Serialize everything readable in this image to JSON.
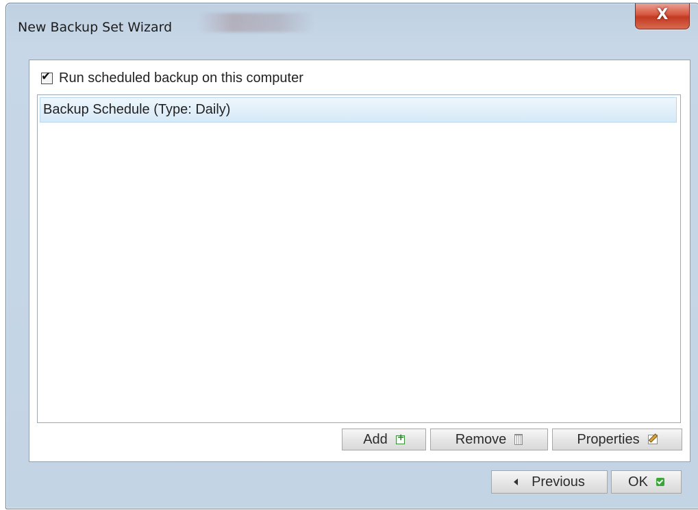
{
  "window": {
    "title": "New Backup Set Wizard",
    "close_glyph": "X"
  },
  "schedule": {
    "run_scheduled_label": "Run scheduled backup on this computer",
    "run_scheduled_checked": true,
    "items": [
      {
        "label": "Backup Schedule (Type: Daily)",
        "selected": true
      }
    ]
  },
  "list_actions": {
    "add_label": "Add",
    "remove_label": "Remove",
    "properties_label": "Properties"
  },
  "navigation": {
    "previous_label": "Previous",
    "ok_label": "OK"
  },
  "icons": {
    "add": "add-icon",
    "remove": "trash-icon",
    "properties": "edit-icon",
    "previous": "arrow-left-icon",
    "ok": "check-icon"
  },
  "colors": {
    "window_frame": "#c3d4e5",
    "selection": "#d6e9f7",
    "close_button": "#d7573f",
    "ok_icon": "#3aa63a"
  }
}
